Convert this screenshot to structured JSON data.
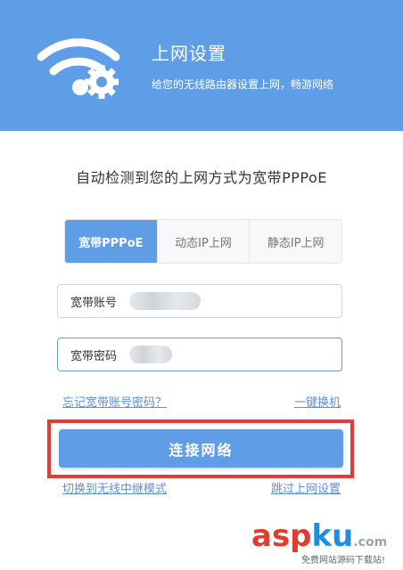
{
  "header": {
    "title": "上网设置",
    "subtitle": "给您的无线路由器设置上网，畅游网络"
  },
  "detect_text": "自动检测到您的上网方式为宽带PPPoE",
  "tabs": [
    {
      "label": "宽带PPPoE",
      "active": true
    },
    {
      "label": "动态IP上网",
      "active": false
    },
    {
      "label": "静态IP上网",
      "active": false
    }
  ],
  "fields": {
    "account_label": "宽带账号",
    "password_label": "宽带密码"
  },
  "links": {
    "forgot": "忘记宽带账号密码？",
    "one_key": "一键换机"
  },
  "connect_button": "连接网络",
  "bottom_links": {
    "switch": "切换到无线中继模式",
    "skip": "跳过上网设置"
  },
  "watermark": {
    "part1": "asp",
    "part2": "ku",
    "part3": ".com",
    "subtitle": "免费网站源码下载站!"
  },
  "colors": {
    "header": "#5f9de6",
    "highlight": "#e43a3a"
  }
}
